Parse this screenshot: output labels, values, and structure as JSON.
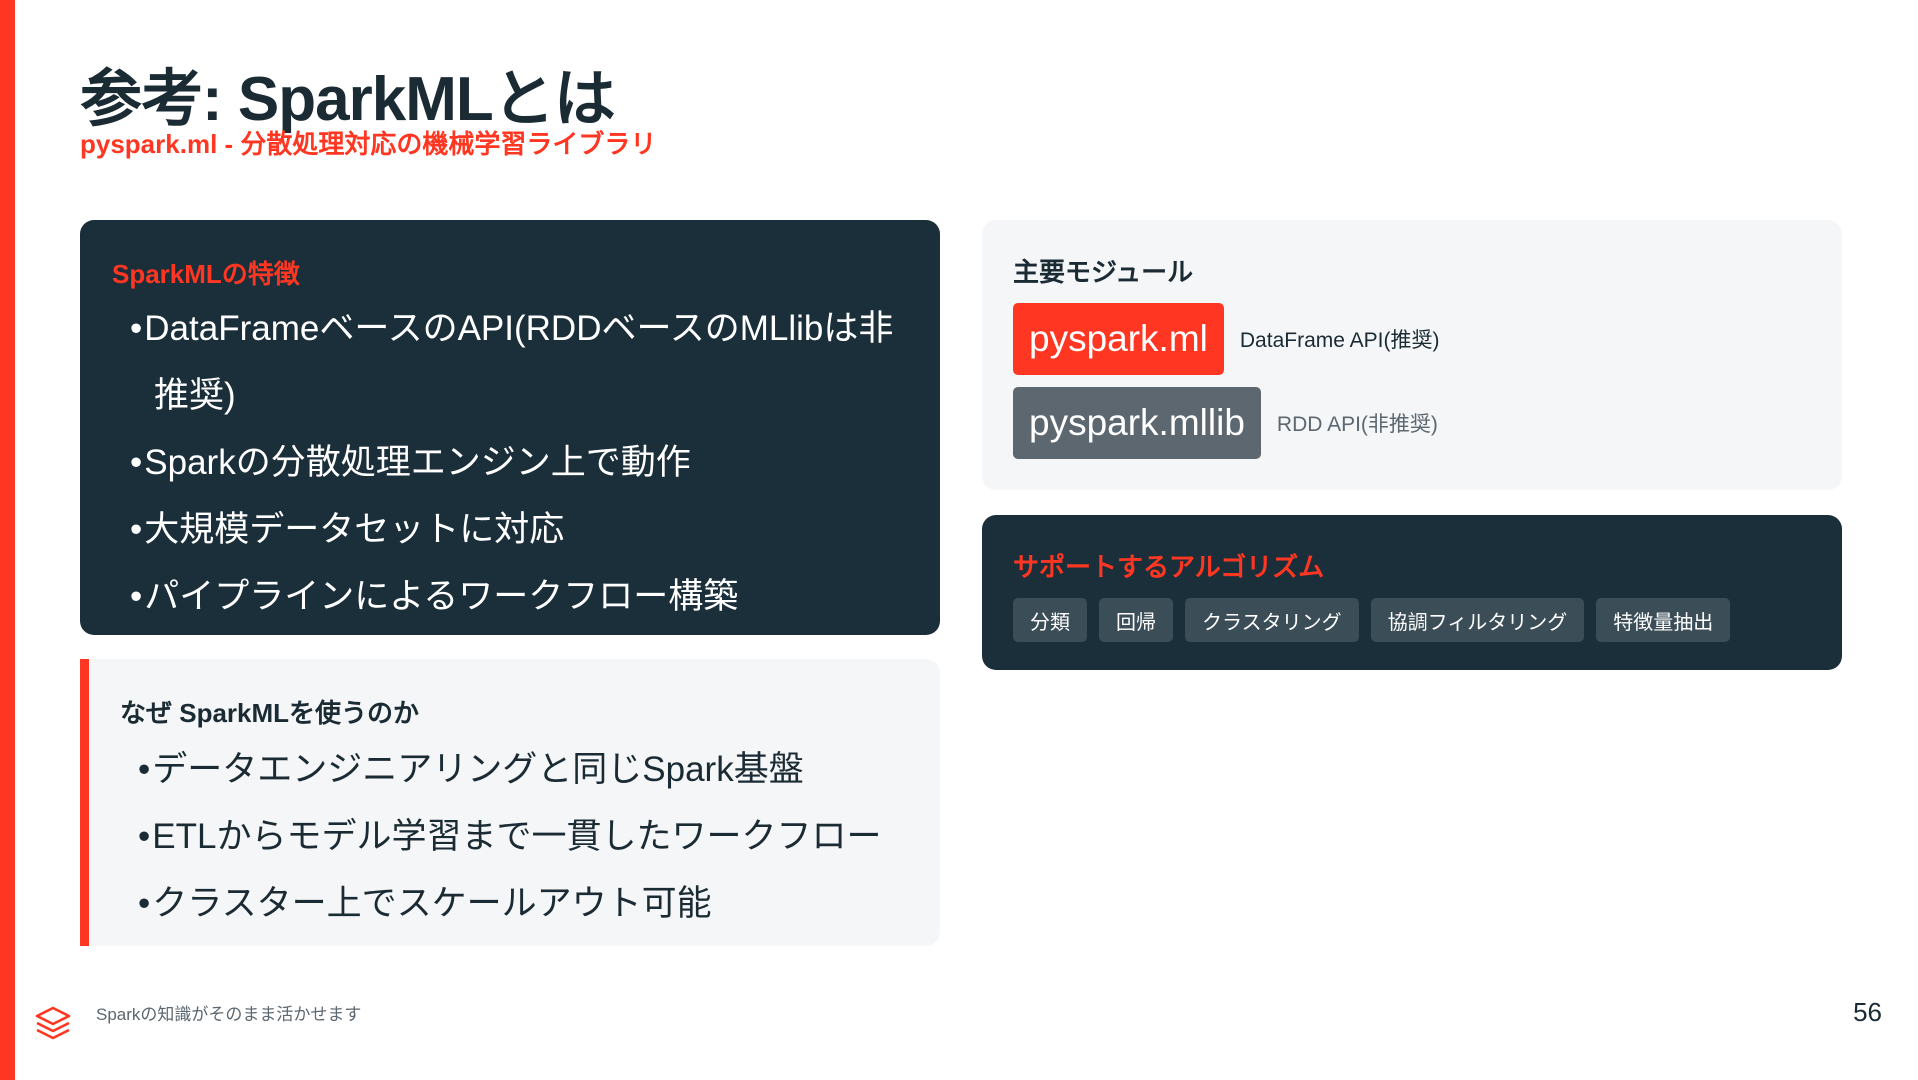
{
  "slide": {
    "title": "参考: SparkMLとは",
    "subtitle": "pyspark.ml - 分散処理対応の機械学習ライブラリ",
    "page_number": "56",
    "footer_text": "Sparkの知識がそのまま活かせます"
  },
  "features": {
    "heading": "SparkMLの特徴",
    "items": [
      "DataFrameベースのAPI(RDDベースのMLlibは非推奨)",
      "Sparkの分散処理エンジン上で動作",
      "大規模データセットに対応",
      "パイプラインによるワークフロー構築"
    ]
  },
  "why": {
    "heading": "なぜ SparkMLを使うのか",
    "items": [
      "データエンジニアリングと同じSpark基盤",
      "ETLからモデル学習まで一貫したワークフロー",
      "クラスター上でスケールアウト可能"
    ]
  },
  "modules": {
    "heading": "主要モジュール",
    "items": [
      {
        "name": "pyspark.ml",
        "desc": "DataFrame API(推奨)"
      },
      {
        "name": "pyspark.mllib",
        "desc": "RDD API(非推奨)"
      }
    ]
  },
  "algorithms": {
    "heading": "サポートするアルゴリズム",
    "tags": [
      "分類",
      "回帰",
      "クラスタリング",
      "協調フィルタリング",
      "特徴量抽出"
    ]
  },
  "colors": {
    "accent": "#ff3621",
    "navy": "#1b2f3a",
    "light_panel": "#f5f6f8",
    "gray_pill": "#5c6770",
    "tag_bg": "#3b4d57"
  },
  "icons": {
    "footer_logo": "databricks-layers-icon"
  }
}
